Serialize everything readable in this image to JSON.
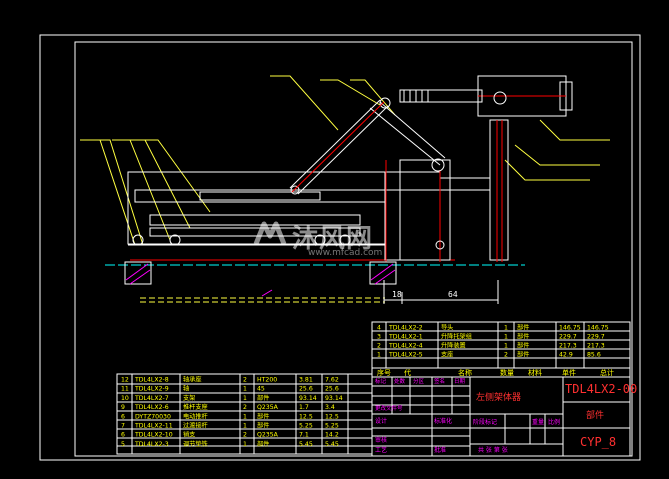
{
  "drawing": {
    "dimensions": {
      "dim_left": "18",
      "dim_right": "64"
    },
    "parts_upper": [
      {
        "no": "4",
        "code": "TDL4LX2-2",
        "name": "导头",
        "qty": "1",
        "mat": "部件",
        "w1": "146.75",
        "w2": "146.75"
      },
      {
        "no": "3",
        "code": "TDL4LX2-1",
        "name": "升降托架组",
        "qty": "1",
        "mat": "部件",
        "w1": "229.7",
        "w2": "229.7"
      },
      {
        "no": "2",
        "code": "TDL4LX2-4",
        "name": "升降装置",
        "qty": "1",
        "mat": "部件",
        "w1": "217.3",
        "w2": "217.3"
      },
      {
        "no": "1",
        "code": "TDL4LX2-5",
        "name": "支座",
        "qty": "2",
        "mat": "部件",
        "w1": "42.9",
        "w2": "85.6"
      }
    ],
    "header_labels": {
      "h_no": "序号",
      "h_code": "代",
      "h_name": "名称",
      "h_qty": "数量",
      "h_mat": "材料",
      "h_w1": "单件",
      "h_w2": "总计"
    },
    "parts_lower": [
      {
        "no": "12",
        "code": "TDL4LX2-8",
        "name": "轴承座",
        "qty": "2",
        "mat": "HT200",
        "w1": "3.81",
        "w2": "7.62"
      },
      {
        "no": "11",
        "code": "TDL4LX2-9",
        "name": "轴",
        "qty": "1",
        "mat": "45",
        "w1": "25.6",
        "w2": "25.6"
      },
      {
        "no": "10",
        "code": "TDL4LX2-7",
        "name": "支架",
        "qty": "1",
        "mat": "部件",
        "w1": "93.14",
        "w2": "93.14"
      },
      {
        "no": "9",
        "code": "TDL4LX2-6",
        "name": "推杆支座",
        "qty": "2",
        "mat": "Q235A",
        "w1": "1.7",
        "w2": "3.4"
      },
      {
        "no": "6",
        "code": "DYTZ70030",
        "name": "电动推杆",
        "qty": "1",
        "mat": "部件",
        "w1": "12.5",
        "w2": "12.5"
      },
      {
        "no": "7",
        "code": "TDL4LX2-11",
        "name": "过渡接杆",
        "qty": "1",
        "mat": "部件",
        "w1": "5.25",
        "w2": "5.25"
      },
      {
        "no": "6",
        "code": "TDL4LX2-10",
        "name": "销支",
        "qty": "2",
        "mat": "Q235A",
        "w1": "7.1",
        "w2": "14.2"
      },
      {
        "no": "5",
        "code": "TDL4LX2-3",
        "name": "调节垫铁",
        "qty": "1",
        "mat": "部件",
        "w1": "5.45",
        "w2": "5.45"
      }
    ],
    "title_block": {
      "part_code": "TDL4LX2-00",
      "part_name": "左侧架体器",
      "type_label": "部件",
      "doc_code": "CYP_8",
      "label_weight": "重量",
      "label_scale": "比例",
      "label_sheet": "共 张 第 张",
      "label_stage": "阶段标记",
      "label_design": "设计",
      "label_check": "审核",
      "label_std": "标准化",
      "label_process": "工艺",
      "label_approve": "批准",
      "label_date": "日期",
      "label_sign": "签名",
      "label_mark": "标记",
      "label_count": "处数",
      "label_zone": "分区",
      "label_change": "更改文件号",
      "label_total_weight": "重量"
    }
  },
  "watermark": {
    "brand": "沐风网",
    "url": "www.mfcad.com"
  },
  "colors": {
    "background": "#000000",
    "frame": "#ffffff",
    "table_text": "#ffff00",
    "title_text": "#ff3030",
    "red_line": "#ff0000",
    "hatch": "#ff00ff",
    "geometry": "#ffffff",
    "centerline": "#00ffff"
  }
}
